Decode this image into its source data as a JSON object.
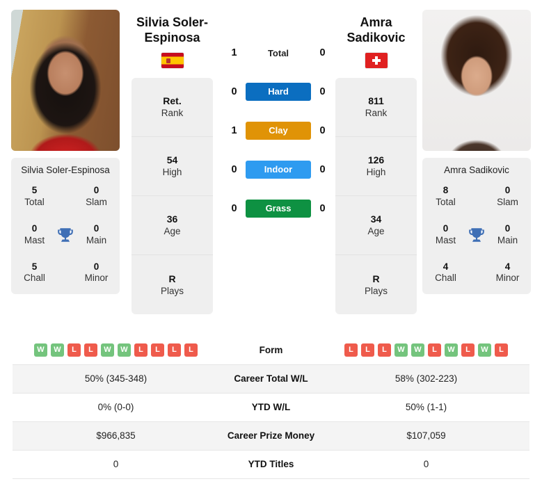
{
  "players": {
    "left": {
      "name_display": "Silvia Soler-\nEspinosa",
      "name_line1": "Silvia Soler-",
      "name_line2": "Espinosa",
      "card_name": "Silvia Soler-Espinosa",
      "country_flag": "spain-flag",
      "info": [
        {
          "value": "Ret.",
          "label": "Rank"
        },
        {
          "value": "54",
          "label": "High"
        },
        {
          "value": "36",
          "label": "Age"
        },
        {
          "value": "R",
          "label": "Plays"
        }
      ],
      "titles": {
        "total_value": "5",
        "total_label": "Total",
        "slam_value": "0",
        "slam_label": "Slam",
        "mast_value": "0",
        "mast_label": "Mast",
        "main_value": "0",
        "main_label": "Main",
        "chall_value": "5",
        "chall_label": "Chall",
        "minor_value": "0",
        "minor_label": "Minor"
      },
      "form": [
        "W",
        "W",
        "L",
        "L",
        "W",
        "W",
        "L",
        "L",
        "L",
        "L"
      ],
      "career_total_wl": "50% (345-348)",
      "ytd_wl": "0% (0-0)",
      "career_prize_money": "$966,835",
      "ytd_titles": "0"
    },
    "right": {
      "name_line1": "Amra",
      "name_line2": "Sadikovic",
      "card_name": "Amra Sadikovic",
      "country_flag": "switzerland-flag",
      "info": [
        {
          "value": "811",
          "label": "Rank"
        },
        {
          "value": "126",
          "label": "High"
        },
        {
          "value": "34",
          "label": "Age"
        },
        {
          "value": "R",
          "label": "Plays"
        }
      ],
      "titles": {
        "total_value": "8",
        "total_label": "Total",
        "slam_value": "0",
        "slam_label": "Slam",
        "mast_value": "0",
        "mast_label": "Mast",
        "main_value": "0",
        "main_label": "Main",
        "chall_value": "4",
        "chall_label": "Chall",
        "minor_value": "4",
        "minor_label": "Minor"
      },
      "form": [
        "L",
        "L",
        "L",
        "W",
        "W",
        "L",
        "W",
        "L",
        "W",
        "L"
      ],
      "career_total_wl": "58% (302-223)",
      "ytd_wl": "50% (1-1)",
      "career_prize_money": "$107,059",
      "ytd_titles": "0"
    }
  },
  "head_to_head": [
    {
      "left": "1",
      "label": "Total",
      "right": "0",
      "style": "plain"
    },
    {
      "left": "0",
      "label": "Hard",
      "right": "0",
      "style": "badge",
      "color": "#0b6ec0"
    },
    {
      "left": "1",
      "label": "Clay",
      "right": "0",
      "style": "badge",
      "color": "#e09306"
    },
    {
      "left": "0",
      "label": "Indoor",
      "right": "0",
      "style": "badge",
      "color": "#2e9bf0"
    },
    {
      "left": "0",
      "label": "Grass",
      "right": "0",
      "style": "badge",
      "color": "#0e9142"
    }
  ],
  "comparison_rows": [
    {
      "label": "Form",
      "type": "form"
    },
    {
      "label": "Career Total W/L",
      "type": "text",
      "left": "50% (345-348)",
      "right": "58% (302-223)"
    },
    {
      "label": "YTD W/L",
      "type": "text",
      "left": "0% (0-0)",
      "right": "50% (1-1)"
    },
    {
      "label": "Career Prize Money",
      "type": "text",
      "left": "$966,835",
      "right": "$107,059"
    },
    {
      "label": "YTD Titles",
      "type": "text",
      "left": "0",
      "right": "0"
    }
  ],
  "colors": {
    "win": "#74c47d",
    "loss": "#ef5b4c",
    "hard": "#0b6ec0",
    "clay": "#e09306",
    "indoor": "#2e9bf0",
    "grass": "#0e9142",
    "trophy": "#3f6fb5",
    "card_bg": "#efefef"
  }
}
